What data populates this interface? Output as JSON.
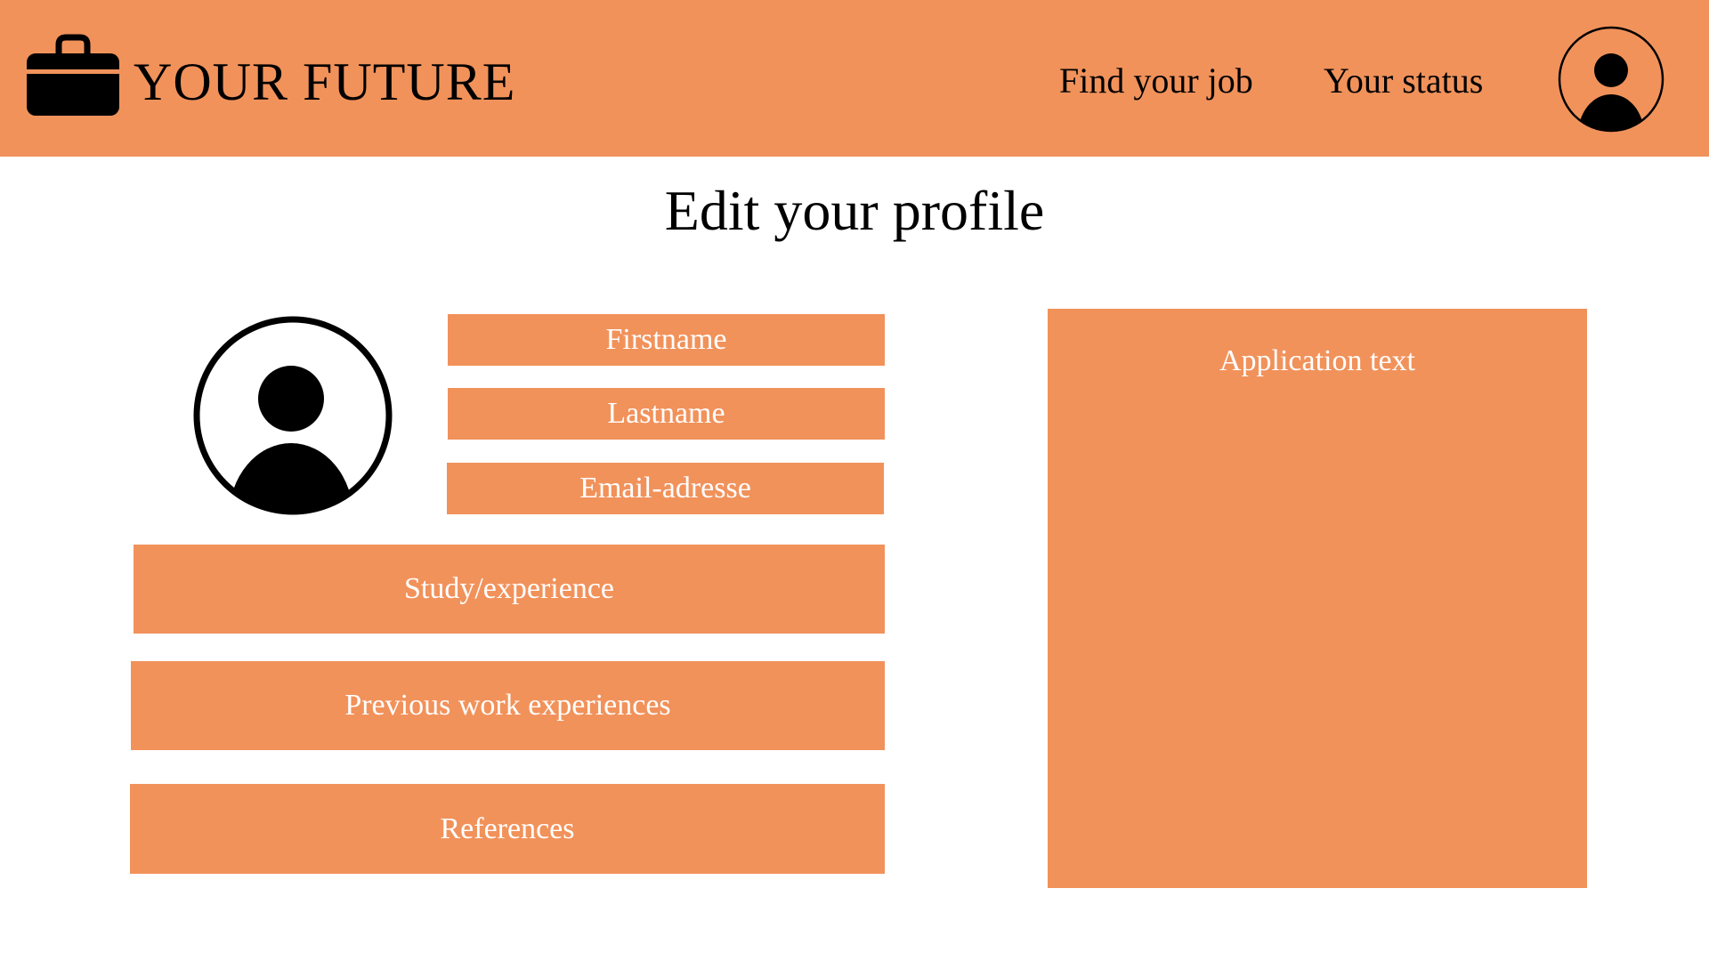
{
  "header": {
    "brand": "YOUR FUTURE",
    "logo_icon": "briefcase-icon",
    "nav": {
      "find_job": "Find your job",
      "status": "Your status"
    },
    "avatar_icon": "user-avatar-icon"
  },
  "page": {
    "title": "Edit your profile"
  },
  "profile": {
    "avatar_icon": "user-avatar-icon",
    "fields": {
      "firstname": "Firstname",
      "lastname": "Lastname",
      "email": "Email-adresse",
      "study": "Study/experience",
      "previous_work": "Previous work experiences",
      "references": "References"
    },
    "application_text": "Application text"
  },
  "colors": {
    "accent": "#F1925B",
    "field_text": "#FFFFFF",
    "background": "#FFFFFF",
    "ink": "#000000"
  }
}
